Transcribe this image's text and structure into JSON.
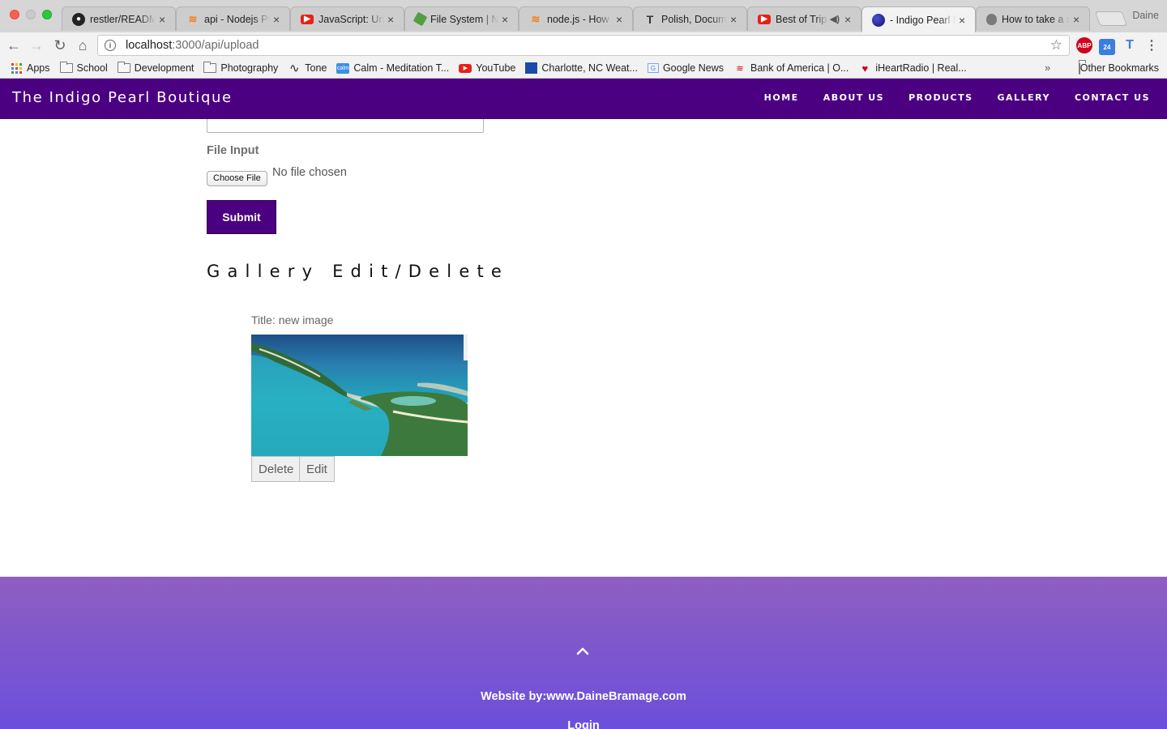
{
  "browser": {
    "tabs": [
      {
        "title": "restler/README.md",
        "icon": "github-icon",
        "color": "#222222"
      },
      {
        "title": "api - Nodejs POST",
        "icon": "stackoverflow-icon",
        "color": "#f48024"
      },
      {
        "title": "JavaScript: Understanding",
        "icon": "youtube-icon",
        "color": "#e62117"
      },
      {
        "title": "File System | Node",
        "icon": "nodejs-icon",
        "color": "#539e43"
      },
      {
        "title": "node.js - How to",
        "icon": "stackoverflow-icon",
        "color": "#f48024"
      },
      {
        "title": "Polish, Document",
        "icon": "typora-icon",
        "color": "#333333"
      },
      {
        "title": "Best of Trip-",
        "icon": "youtube-icon",
        "color": "#e62117"
      },
      {
        "title": "- Indigo Pearl Boutique",
        "icon": "indigo-globe-icon",
        "color": "#1d1f8e"
      },
      {
        "title": "How to take a screenshot",
        "icon": "apple-icon",
        "color": "#7a7a7a"
      }
    ],
    "profile_name": "Daine",
    "url_host": "localhost",
    "url_rest": ":3000/api/upload",
    "bookmarks": [
      {
        "label": "Apps",
        "icon": "apps-grid-icon"
      },
      {
        "label": "School",
        "icon": "folder-icon"
      },
      {
        "label": "Development",
        "icon": "folder-icon"
      },
      {
        "label": "Photography",
        "icon": "folder-icon"
      },
      {
        "label": "Tone",
        "icon": "tone-wave-icon"
      },
      {
        "label": "Calm - Meditation T...",
        "icon": "calm-icon"
      },
      {
        "label": "YouTube",
        "icon": "youtube-icon"
      },
      {
        "label": "Charlotte, NC Weat...",
        "icon": "weather-channel-icon"
      },
      {
        "label": "Google News",
        "icon": "google-news-icon"
      },
      {
        "label": "Bank of America | O...",
        "icon": "bank-of-america-icon"
      },
      {
        "label": "iHeartRadio | Real...",
        "icon": "iheartradio-icon"
      }
    ],
    "other_bookmarks": "Other Bookmarks",
    "adblock_label": "ABP",
    "calendar_day": "24"
  },
  "site": {
    "brand": "The Indigo Pearl Boutique",
    "nav": [
      "HOME",
      "ABOUT US",
      "PRODUCTS",
      "GALLERY",
      "CONTACT US"
    ],
    "accent_color": "#4b0082"
  },
  "form": {
    "file_label": "File Input",
    "choose_file_label": "Choose File",
    "no_file_text": "No file chosen",
    "submit_label": "Submit"
  },
  "gallery": {
    "heading": "Gallery Edit/Delete",
    "items": [
      {
        "title": "Title: new image",
        "image": "tropical-island-aerial-photo",
        "delete_label": "Delete",
        "edit_label": "Edit"
      }
    ]
  },
  "footer": {
    "credit": "Website by:www.DaineBramage.com",
    "login": "Login"
  }
}
